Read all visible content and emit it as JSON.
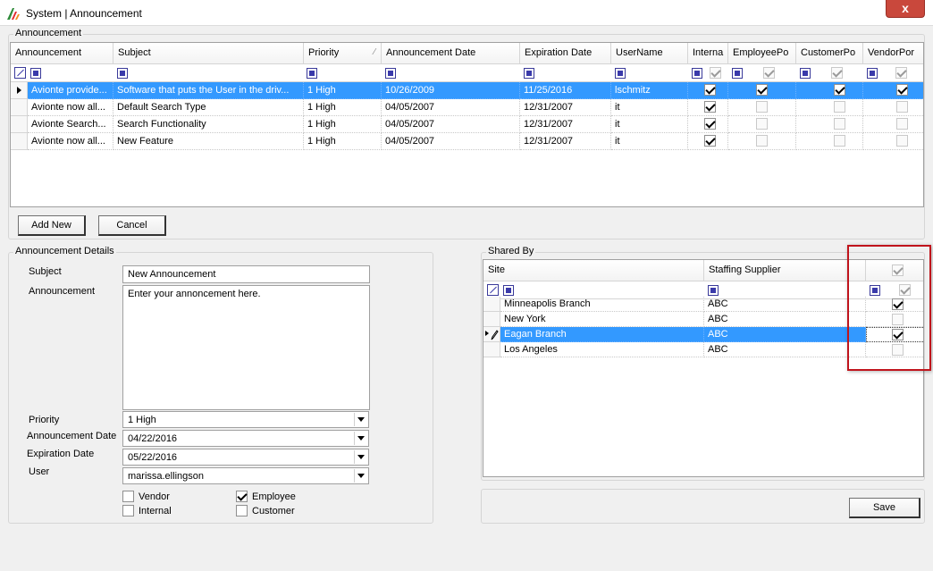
{
  "window": {
    "title": "System | Announcement",
    "close_label": "x"
  },
  "announcement_grid": {
    "legend": "Announcement",
    "columns": [
      "Announcement",
      "Subject",
      "Priority",
      "Announcement Date",
      "Expiration Date",
      "UserName",
      "Interna",
      "EmployeePo",
      "CustomerPo",
      "VendorPor"
    ],
    "rows": [
      {
        "announcement": "Avionte provide...",
        "subject": "Software that puts the User in the driv...",
        "priority": "1 High",
        "ann_date": "10/26/2009",
        "exp_date": "11/25/2016",
        "user": "lschmitz",
        "internal": true,
        "employee": true,
        "customer": true,
        "vendor": true,
        "selected": true
      },
      {
        "announcement": "Avionte now all...",
        "subject": "Default Search Type",
        "priority": "1 High",
        "ann_date": "04/05/2007",
        "exp_date": "12/31/2007",
        "user": "it",
        "internal": true,
        "employee": false,
        "customer": false,
        "vendor": false,
        "selected": false
      },
      {
        "announcement": "Avionte Search...",
        "subject": "Search Functionality",
        "priority": "1 High",
        "ann_date": "04/05/2007",
        "exp_date": "12/31/2007",
        "user": "it",
        "internal": true,
        "employee": false,
        "customer": false,
        "vendor": false,
        "selected": false
      },
      {
        "announcement": "Avionte now all...",
        "subject": "New Feature",
        "priority": "1 High",
        "ann_date": "04/05/2007",
        "exp_date": "12/31/2007",
        "user": "it",
        "internal": true,
        "employee": false,
        "customer": false,
        "vendor": false,
        "selected": false
      }
    ]
  },
  "buttons": {
    "add_new": "Add New",
    "cancel": "Cancel",
    "save": "Save"
  },
  "details": {
    "legend": "Announcement Details",
    "subject_label": "Subject",
    "subject_value": "New Announcement",
    "announcement_label": "Announcement",
    "announcement_value": "Enter your annoncement here.",
    "priority_label": "Priority",
    "priority_value": "1 High",
    "ann_date_label": "Announcement Date",
    "ann_date_value": "04/22/2016",
    "exp_date_label": "Expiration Date",
    "exp_date_value": "05/22/2016",
    "user_label": "User",
    "user_value": "marissa.ellingson",
    "checks": {
      "vendor": "Vendor",
      "employee": "Employee",
      "internal": "Internal",
      "customer": "Customer"
    },
    "check_state": {
      "vendor": false,
      "employee": true,
      "internal": false,
      "customer": false
    }
  },
  "shared_by": {
    "legend": "Shared By",
    "columns": [
      "Site",
      "Staffing Supplier"
    ],
    "rows": [
      {
        "site": "Minneapolis Branch",
        "supplier": "ABC",
        "checked": true,
        "selected": false
      },
      {
        "site": "New York",
        "supplier": "ABC",
        "checked": false,
        "selected": false
      },
      {
        "site": "Eagan Branch",
        "supplier": "ABC",
        "checked": true,
        "selected": true
      },
      {
        "site": "Los Angeles",
        "supplier": "ABC",
        "checked": false,
        "selected": false
      }
    ]
  },
  "colors": {
    "selection": "#3399ff",
    "highlight_box": "#c0141c",
    "close_button": "#c9483c"
  },
  "icons": {
    "app": "avionte-logo-icon",
    "clear_filter": "clear-filter-icon",
    "filter": "filter-icon",
    "row_pointer": "row-pointer-icon",
    "edit_pencil": "edit-pencil-icon",
    "dropdown": "chevron-down-icon"
  }
}
